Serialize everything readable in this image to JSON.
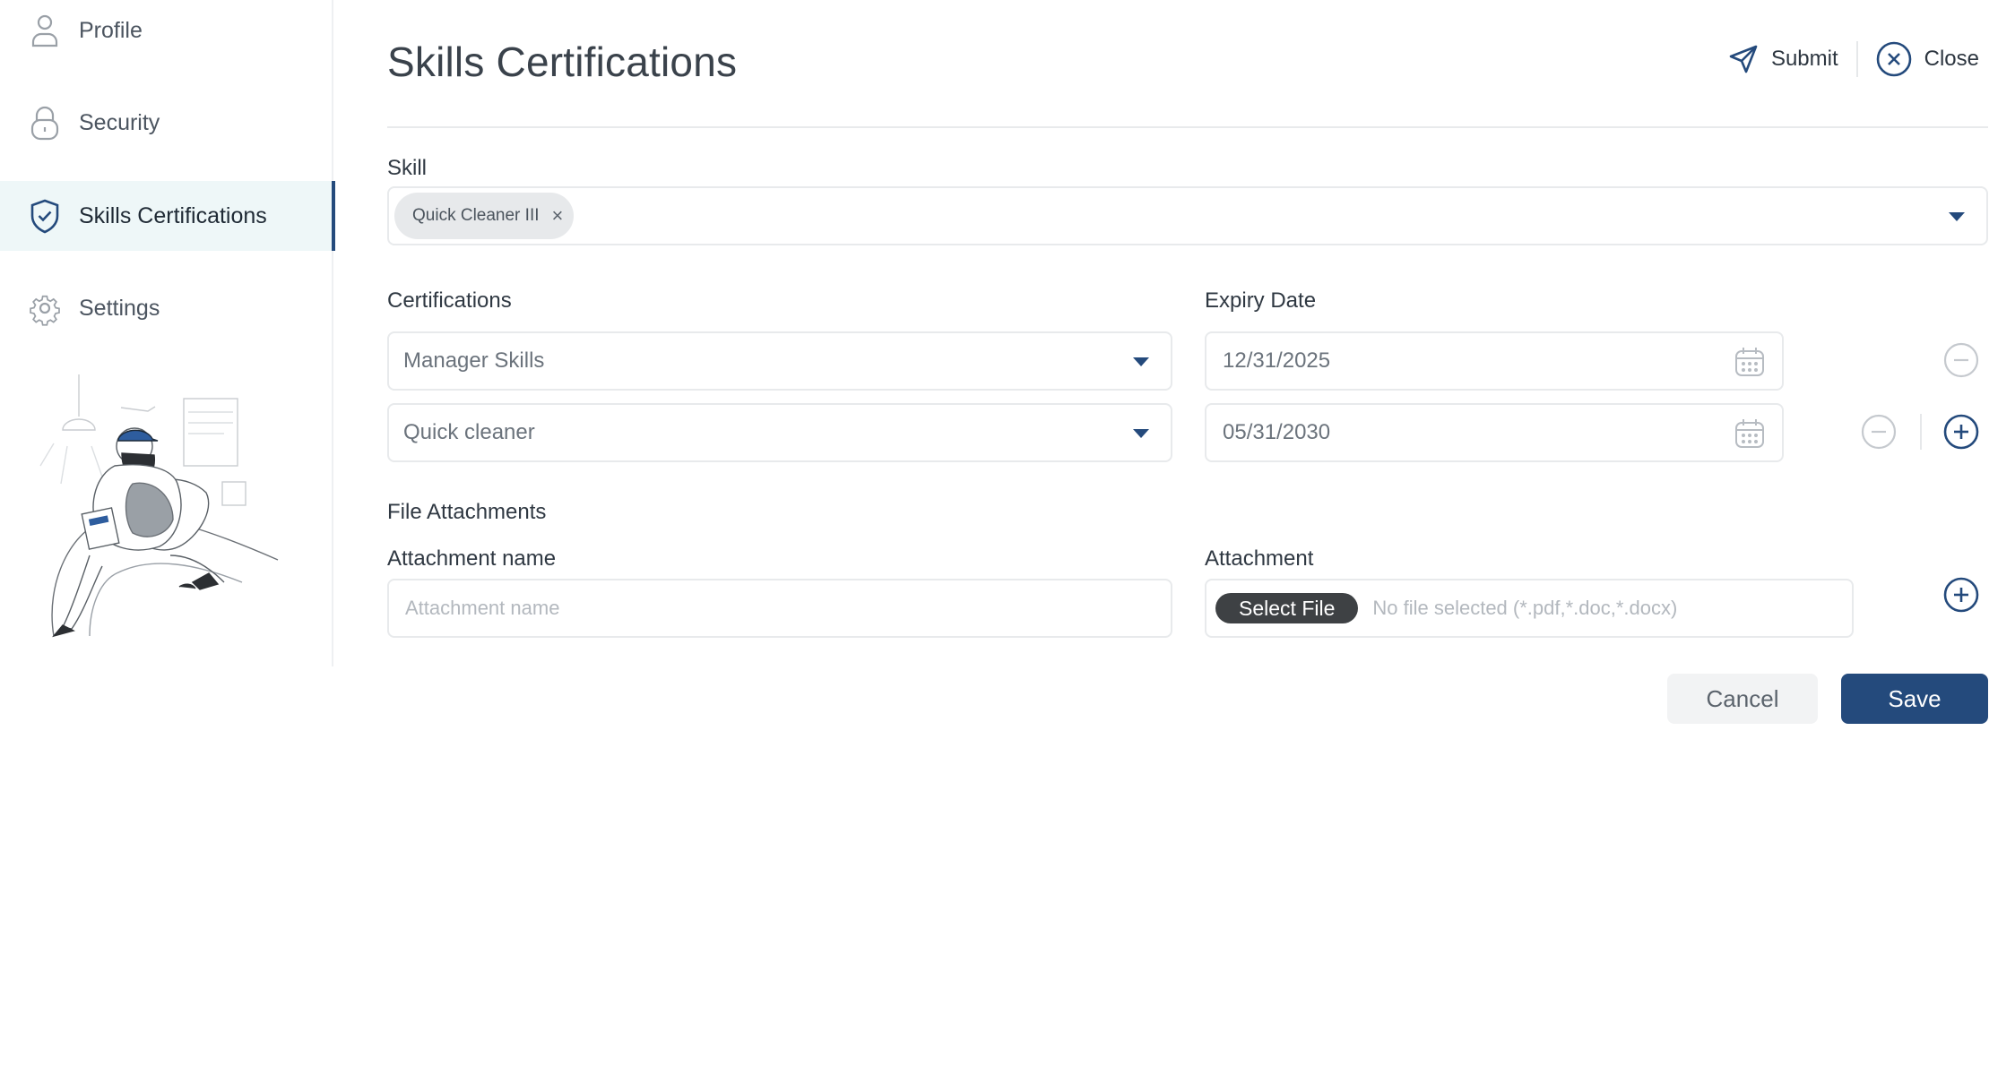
{
  "sidebar": {
    "items": [
      {
        "label": "Profile",
        "icon": "user-icon"
      },
      {
        "label": "Security",
        "icon": "lock-icon"
      },
      {
        "label": "Skills Certifications",
        "icon": "shield-check-icon",
        "active": true
      },
      {
        "label": "Settings",
        "icon": "gear-icon"
      }
    ]
  },
  "header": {
    "title": "Skills Certifications",
    "submit_label": "Submit",
    "close_label": "Close"
  },
  "skill": {
    "label": "Skill",
    "selected_chip": "Quick Cleaner III",
    "chip_remove": "×"
  },
  "certifications": {
    "label": "Certifications",
    "expiry_label": "Expiry Date",
    "rows": [
      {
        "certification": "Manager Skills",
        "expiry": "12/31/2025"
      },
      {
        "certification": "Quick cleaner",
        "expiry": "05/31/2030"
      }
    ]
  },
  "attachments": {
    "section_label": "File Attachments",
    "name_label": "Attachment name",
    "name_placeholder": "Attachment name",
    "attachment_label": "Attachment",
    "select_file_label": "Select File",
    "file_hint": "No file selected (*.pdf,*.doc,*.docx)"
  },
  "footer": {
    "cancel_label": "Cancel",
    "save_label": "Save"
  },
  "colors": {
    "accent": "#244a7c",
    "active_nav_bg": "#eef7f8",
    "border": "#e8eaec"
  }
}
